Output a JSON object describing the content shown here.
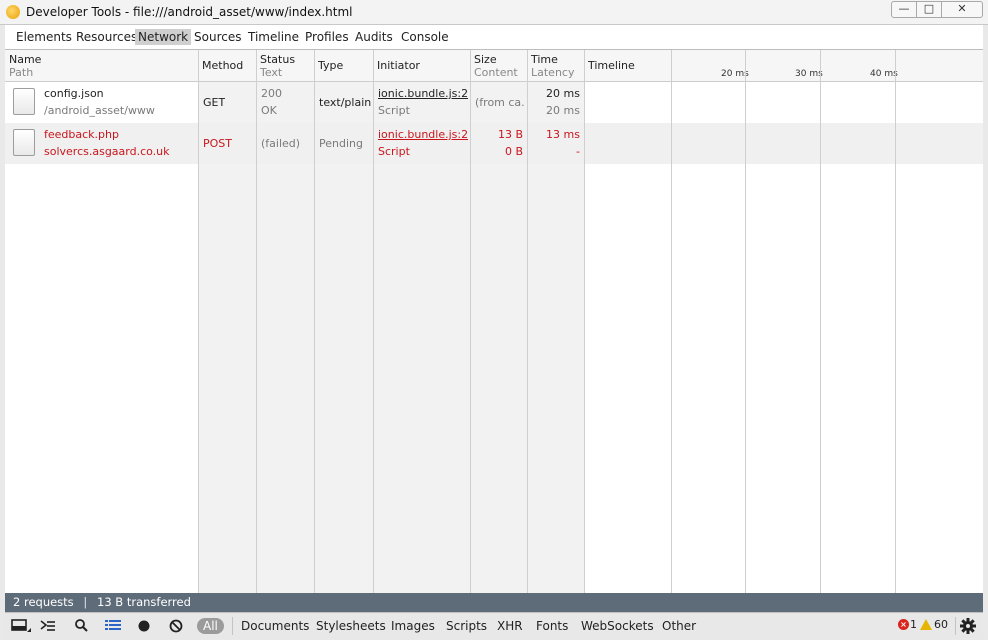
{
  "window": {
    "title": "Developer Tools - file:///android_asset/www/index.html"
  },
  "tabs": [
    {
      "label": "Elements"
    },
    {
      "label": "Resources"
    },
    {
      "label": "Network",
      "active": true
    },
    {
      "label": "Sources"
    },
    {
      "label": "Timeline"
    },
    {
      "label": "Profiles"
    },
    {
      "label": "Audits"
    },
    {
      "label": "Console"
    }
  ],
  "columns": {
    "name": {
      "title": "Name",
      "sub": "Path"
    },
    "method": {
      "title": "Method"
    },
    "status": {
      "title": "Status",
      "sub": "Text"
    },
    "type": {
      "title": "Type"
    },
    "initiator": {
      "title": "Initiator"
    },
    "size": {
      "title": "Size",
      "sub": "Content"
    },
    "time": {
      "title": "Time",
      "sub": "Latency"
    },
    "timeline": {
      "title": "Timeline"
    }
  },
  "timeline_ticks": [
    "20 ms",
    "30 ms",
    "40 ms"
  ],
  "requests": [
    {
      "name": "config.json",
      "path": "/android_asset/www",
      "method": "GET",
      "status": "200",
      "status_text": "OK",
      "type": "text/plain",
      "initiator": "ionic.bundle.js:2...",
      "initiator_type": "Script",
      "size": "(from ca...",
      "content": "",
      "time": "20 ms",
      "latency": "20 ms",
      "failed": false
    },
    {
      "name": "feedback.php",
      "path": "solvercs.asgaard.co.uk",
      "method": "POST",
      "status": "(failed)",
      "status_text": "",
      "type": "Pending",
      "initiator": "ionic.bundle.js:2...",
      "initiator_type": "Script",
      "size": "13 B",
      "content": "0 B",
      "time": "13 ms",
      "latency": "-",
      "failed": true
    }
  ],
  "status_bar": {
    "requests": "2 requests",
    "transferred": "13 B transferred"
  },
  "bottom_bar": {
    "filters": [
      "All",
      "Documents",
      "Stylesheets",
      "Images",
      "Scripts",
      "XHR",
      "Fonts",
      "WebSockets",
      "Other"
    ],
    "error_count": "1",
    "warning_count": "60"
  },
  "colors": {
    "error_red": "#c8161d",
    "status_bar_bg": "#5e6b79",
    "active_tab_bg": "#cfcfcf"
  }
}
